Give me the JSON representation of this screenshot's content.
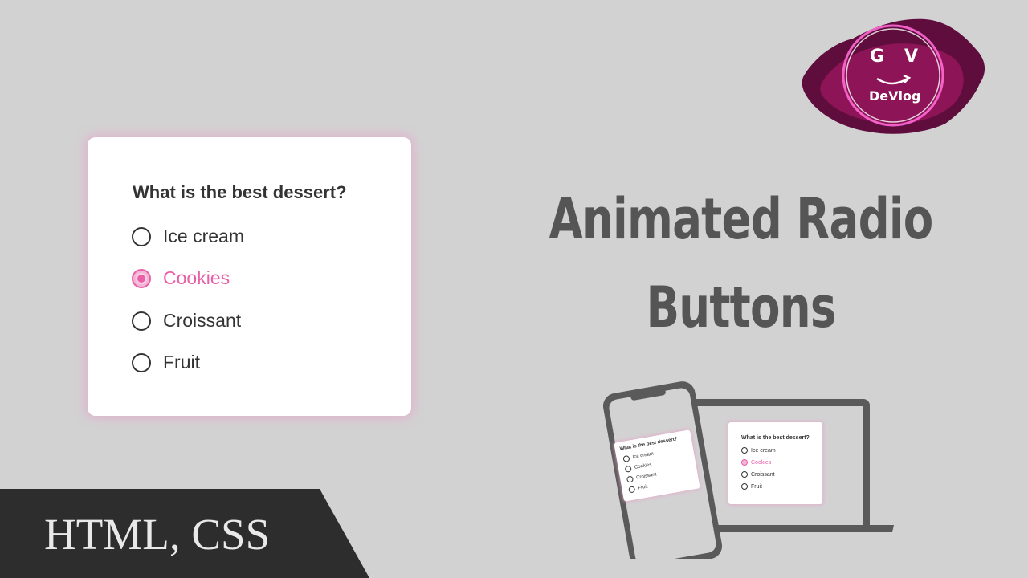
{
  "quiz": {
    "question": "What is the best dessert?",
    "options": [
      {
        "label": "Ice cream",
        "checked": false
      },
      {
        "label": "Cookies",
        "checked": true
      },
      {
        "label": "Croissant",
        "checked": false
      },
      {
        "label": "Fruit",
        "checked": false
      }
    ]
  },
  "headline": {
    "line1": "Animated Radio",
    "line2": "Buttons"
  },
  "banner": {
    "text": "HTML, CSS"
  },
  "logo": {
    "letter_g": "G",
    "letter_v": "V",
    "brand": "DeVlog"
  },
  "colors": {
    "accent": "#e95fa8",
    "background": "#d3d2d3",
    "text": "#333333",
    "headline": "#555555",
    "banner": "#2d2d2d"
  }
}
